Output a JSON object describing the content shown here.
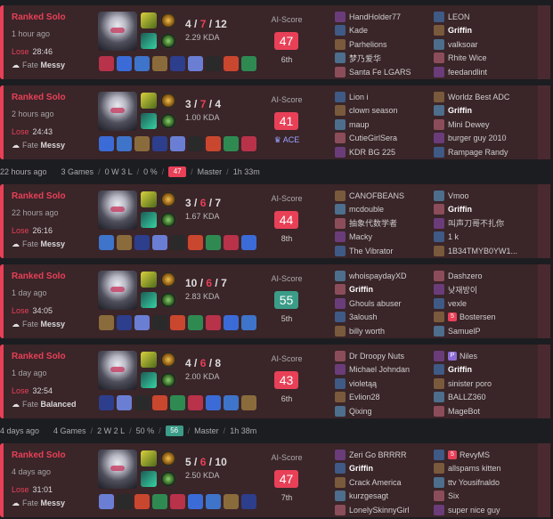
{
  "colors": {
    "lose": "#e84057",
    "score_red": "#e84057",
    "score_teal": "#3b9c88",
    "card_bg": "#3a2529",
    "page_bg": "#1c1d21"
  },
  "ai_label": "AI-Score",
  "summaries": [
    {
      "ago": "22 hours ago",
      "games": "3 Games",
      "record": "0 W 3 L",
      "winrate": "0 %",
      "score": "47",
      "tier": "Master",
      "time": "1h 33m",
      "score_color": "red"
    },
    {
      "ago": "4 days ago",
      "games": "4 Games",
      "record": "2 W 2 L",
      "winrate": "50 %",
      "score": "56",
      "tier": "Master",
      "time": "1h 38m",
      "score_color": "teal"
    }
  ],
  "matches": [
    {
      "mode": "Ranked Solo",
      "ago": "1 hour ago",
      "result": "Lose",
      "duration": "28:46",
      "fate_label": "Fate",
      "fate": "Messy",
      "k": "4",
      "d": "7",
      "a": "12",
      "kda": "2.29 KDA",
      "score": "47",
      "score_color": "red",
      "place": "6th",
      "team1": [
        "HandHolder77",
        "Kade",
        "Parhelions",
        "梦乃爱华",
        "Santa Fe LGARS"
      ],
      "team2": [
        "LEON",
        "Griffin",
        "valksoar",
        "Rhite Wice",
        "feedandlint"
      ]
    },
    {
      "mode": "Ranked Solo",
      "ago": "2 hours ago",
      "result": "Lose",
      "duration": "24:43",
      "fate_label": "Fate",
      "fate": "Messy",
      "k": "3",
      "d": "7",
      "a": "4",
      "kda": "1.00 KDA",
      "score": "41",
      "score_color": "red",
      "place": "ACE",
      "team1": [
        "Lion i",
        "clown season",
        "maup",
        "CutieGirlSera",
        "KDR BG 225"
      ],
      "team2": [
        "Worldz Best ADC",
        "Griffin",
        "Mini Dewey",
        "burger guy 2010",
        "Rampage Randy"
      ]
    },
    {
      "mode": "Ranked Solo",
      "ago": "22 hours ago",
      "result": "Lose",
      "duration": "26:16",
      "fate_label": "Fate",
      "fate": "Messy",
      "k": "3",
      "d": "6",
      "a": "7",
      "kda": "1.67 KDA",
      "score": "44",
      "score_color": "red",
      "place": "8th",
      "team1": [
        "CANOFBEANS",
        "mcdouble",
        "抽象代数学者",
        "Macky",
        "The Vibrator"
      ],
      "team2": [
        "Vmoo",
        "Griffin",
        "叫声刀哥不扎你",
        "1 k",
        "1B34TMYB0YW1..."
      ]
    },
    {
      "mode": "Ranked Solo",
      "ago": "1 day ago",
      "result": "Lose",
      "duration": "34:05",
      "fate_label": "Fate",
      "fate": "Messy",
      "k": "10",
      "d": "6",
      "a": "7",
      "kda": "2.83 KDA",
      "score": "55",
      "score_color": "teal",
      "place": "5th",
      "team1": [
        "whoispaydayXD",
        "Griffin",
        "Ghouls abuser",
        "3aloush",
        "billy worth"
      ],
      "team2": [
        "Dashzero",
        "낮재방이",
        "vexle",
        "Bostersen",
        "SamuelP"
      ]
    },
    {
      "mode": "Ranked Solo",
      "ago": "1 day ago",
      "result": "Lose",
      "duration": "32:54",
      "fate_label": "Fate",
      "fate": "Balanced",
      "k": "4",
      "d": "6",
      "a": "8",
      "kda": "2.00 KDA",
      "score": "43",
      "score_color": "red",
      "place": "6th",
      "team1": [
        "Dr Droopy Nuts",
        "Michael Johndan",
        "violetąą",
        "Evlion28",
        "Qixing"
      ],
      "team2": [
        "Niles",
        "Griffin",
        "sinister poro",
        "BALLZ360",
        "MageBot"
      ]
    },
    {
      "mode": "Ranked Solo",
      "ago": "4 days ago",
      "result": "Lose",
      "duration": "31:01",
      "fate_label": "Fate",
      "fate": "Messy",
      "k": "5",
      "d": "6",
      "a": "10",
      "kda": "2.50 KDA",
      "score": "47",
      "score_color": "red",
      "place": "7th",
      "team1": [
        "Zeri Go BRRRR",
        "Griffin",
        "Crack America",
        "kurzgesagt",
        "LonelySkinnyGirl"
      ],
      "team2": [
        "RevyMS",
        "allspams kitten",
        "ttv Yousifnaldo",
        "Six",
        "super nice guy"
      ]
    }
  ]
}
